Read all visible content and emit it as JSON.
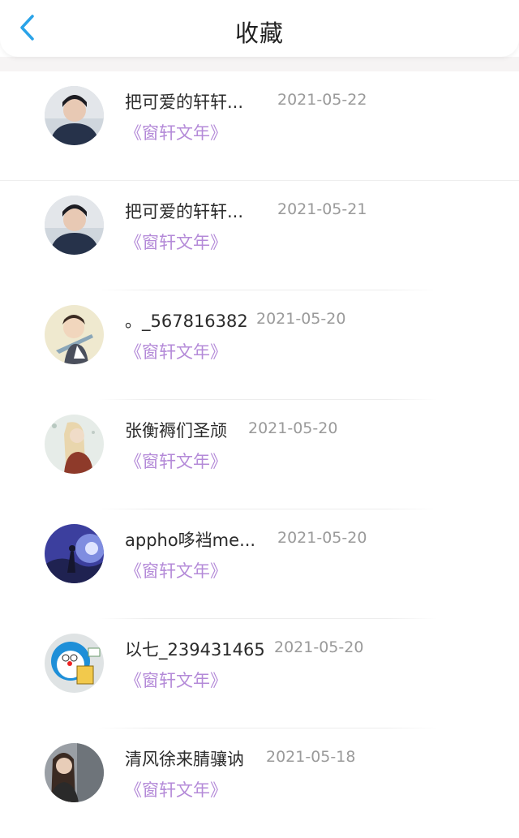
{
  "header": {
    "title": "收藏",
    "back_icon": "chevron-left-icon"
  },
  "colors": {
    "accent": "#2aa3e8",
    "book_title": "#b48ad8",
    "date": "#9a9a9a"
  },
  "favorites": [
    {
      "name": "把可爱的轩轩...",
      "date": "2021-05-22",
      "book": "《窗轩文年》"
    },
    {
      "name": "把可爱的轩轩...",
      "date": "2021-05-21",
      "book": "《窗轩文年》"
    },
    {
      "name": "。_567816382",
      "date": "2021-05-20",
      "book": "《窗轩文年》"
    },
    {
      "name": "张衡褥们圣颃",
      "date": "2021-05-20",
      "book": "《窗轩文年》"
    },
    {
      "name": "appho哆裆me...",
      "date": "2021-05-20",
      "book": "《窗轩文年》"
    },
    {
      "name": "以七_239431465",
      "date": "2021-05-20",
      "book": "《窗轩文年》"
    },
    {
      "name": "清风徐来腈骧讷",
      "date": "2021-05-18",
      "book": "《窗轩文年》"
    }
  ]
}
